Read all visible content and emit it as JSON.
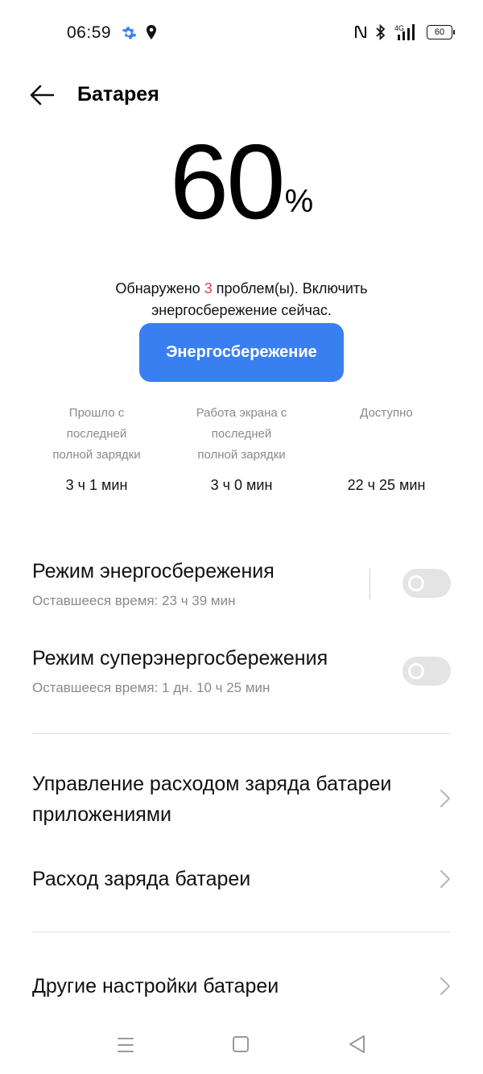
{
  "status_bar": {
    "time": "06:59",
    "battery_level": "60",
    "network": "4G",
    "icons": [
      "gear-icon",
      "location-pin-icon",
      "nfc-icon",
      "bluetooth-icon",
      "signal-icon",
      "battery-icon"
    ]
  },
  "header": {
    "title": "Батарея"
  },
  "battery": {
    "percent_value": "60",
    "percent_sign": "%"
  },
  "problems": {
    "prefix": "Обнаружено ",
    "count": "3",
    "suffix_line1": " проблем(ы). Включить",
    "line2": "энергосбережение сейчас."
  },
  "save_button": {
    "label": "Энергосбережение"
  },
  "stats": [
    {
      "label": "Прошло с последней полной зарядки",
      "value": "3 ч 1 мин"
    },
    {
      "label": "Работа экрана с последней полной зарядки",
      "value": "3 ч 0 мин"
    },
    {
      "label": "Доступно",
      "value": "22 ч 25 мин"
    }
  ],
  "modes": [
    {
      "title": "Режим энергосбережения",
      "subtitle": "Оставшееся время:  23 ч 39 мин",
      "enabled": false
    },
    {
      "title": "Режим суперэнергосбережения",
      "subtitle": "Оставшееся время:  1 дн. 10 ч 25 мин",
      "enabled": false
    }
  ],
  "menu_rows": [
    {
      "label": "Управление расходом заряда батареи приложениями"
    },
    {
      "label": "Расход заряда батареи"
    },
    {
      "label": "Другие настройки батареи"
    }
  ],
  "colors": {
    "accent": "#3a7ff0",
    "problem_count": "#e3464d",
    "secondary_text": "#8a8a8a"
  }
}
